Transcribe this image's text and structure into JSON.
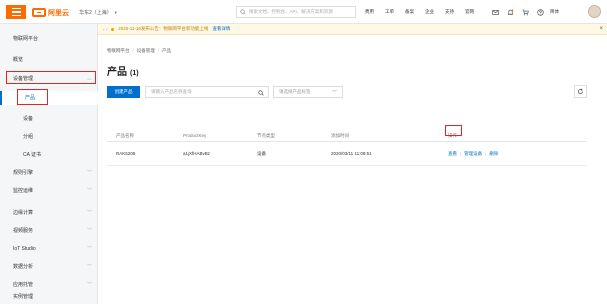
{
  "header": {
    "logo_text": "阿里云",
    "region": "华东2（上海）",
    "search_placeholder": "搜索文档、控制台、API、解决方案和资源",
    "nav": [
      "费用",
      "工单",
      "备案",
      "企业",
      "支持",
      "官网"
    ],
    "lang": "简体"
  },
  "sidebar": {
    "title": "物联网平台",
    "items": [
      {
        "label": "概览",
        "sub": false,
        "chevron": false
      },
      {
        "label": "设备管理",
        "sub": false,
        "chevron": true
      },
      {
        "label": "产品",
        "sub": true,
        "chevron": false
      },
      {
        "label": "设备",
        "sub": true,
        "chevron": false
      },
      {
        "label": "分组",
        "sub": true,
        "chevron": false
      },
      {
        "label": "CA 证书",
        "sub": true,
        "chevron": false
      },
      {
        "label": "规则引擎",
        "sub": false,
        "chevron": true
      },
      {
        "label": "监控运维",
        "sub": false,
        "chevron": true
      },
      {
        "label": "边缘计算",
        "sub": false,
        "chevron": true
      },
      {
        "label": "视频服务",
        "sub": false,
        "chevron": true
      },
      {
        "label": "IoT Studio",
        "sub": false,
        "chevron": true
      },
      {
        "label": "数据分析",
        "sub": false,
        "chevron": true
      },
      {
        "label": "应用托管",
        "sub": false,
        "chevron": true
      },
      {
        "label": "实例管理",
        "sub": false,
        "chevron": false
      }
    ]
  },
  "notice": {
    "text": "2020-11-16发布公告：物联网平台新功能上线",
    "link": "查看详情"
  },
  "breadcrumb": [
    "物联网平台",
    "设备管理",
    "产品"
  ],
  "page": {
    "title": "产品",
    "count": "(1)"
  },
  "toolbar": {
    "create_label": "创建产品",
    "search_placeholder": "请输入产品名称查询",
    "select_placeholder": "请选择产品标签"
  },
  "table": {
    "columns": [
      "产品名称",
      "ProductKey",
      "节点类型",
      "添加时间",
      "操作"
    ],
    "rows": [
      {
        "name": "RAK5205",
        "product_key": "a1jXfHABvBz",
        "node_type": "设备",
        "created": "2020/03/11 11:09:51",
        "actions": [
          "查看",
          "管理设备",
          "删除"
        ]
      }
    ]
  },
  "colors": {
    "brand": "#ff6a00",
    "primary": "#0070cc",
    "highlight": "#e52620"
  }
}
